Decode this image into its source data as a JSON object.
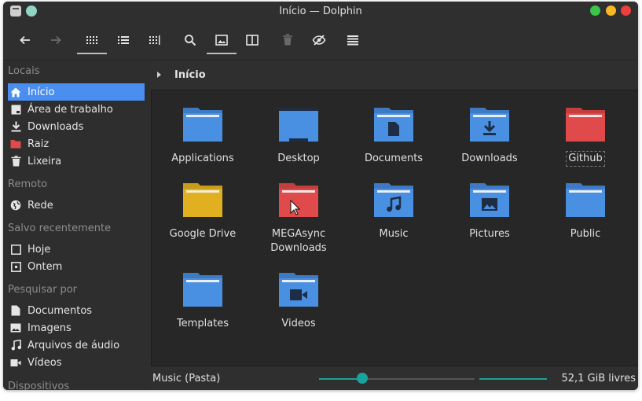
{
  "window": {
    "title": "Início — Dolphin"
  },
  "toolbar": {
    "buttons": [
      {
        "name": "back",
        "icon": "arrow-left-icon"
      },
      {
        "name": "forward",
        "icon": "arrow-right-icon"
      },
      {
        "name": "icons-view",
        "icon": "icons-view-icon",
        "active": true
      },
      {
        "name": "compact-view",
        "icon": "compact-view-icon"
      },
      {
        "name": "details-view",
        "icon": "details-view-icon"
      },
      {
        "name": "search",
        "icon": "search-icon"
      },
      {
        "name": "preview",
        "icon": "image-icon",
        "active": true
      },
      {
        "name": "split",
        "icon": "split-view-icon"
      },
      {
        "name": "trash",
        "icon": "trash-icon"
      },
      {
        "name": "hidden-files",
        "icon": "eye-off-icon"
      },
      {
        "name": "menu",
        "icon": "menu-icon"
      }
    ]
  },
  "sidebar": {
    "sections": {
      "locais": "Locais",
      "remoto": "Remoto",
      "recentes": "Salvo recentemente",
      "pesquisar": "Pesquisar por",
      "dispositivos": "Dispositivos"
    },
    "locais": [
      {
        "label": "Início",
        "icon": "home-icon",
        "selected": true
      },
      {
        "label": "Área de trabalho",
        "icon": "desktop-icon"
      },
      {
        "label": "Downloads",
        "icon": "download-icon"
      },
      {
        "label": "Raiz",
        "icon": "red-folder-icon"
      },
      {
        "label": "Lixeira",
        "icon": "trash-icon"
      }
    ],
    "remoto": [
      {
        "label": "Rede",
        "icon": "network-icon"
      }
    ],
    "recentes": [
      {
        "label": "Hoje",
        "icon": "calendar-today-icon"
      },
      {
        "label": "Ontem",
        "icon": "calendar-yesterday-icon"
      }
    ],
    "pesquisar": [
      {
        "label": "Documentos",
        "icon": "document-icon"
      },
      {
        "label": "Imagens",
        "icon": "image-icon"
      },
      {
        "label": "Arquivos de áudio",
        "icon": "music-icon"
      },
      {
        "label": "Vídeos",
        "icon": "video-icon"
      }
    ]
  },
  "breadcrumb": {
    "current": "Início"
  },
  "files": [
    {
      "label": "Applications",
      "color": "#4a90e2",
      "emblem": "none"
    },
    {
      "label": "Desktop",
      "color": "#4a90e2",
      "emblem": "desktop"
    },
    {
      "label": "Documents",
      "color": "#4a90e2",
      "emblem": "document"
    },
    {
      "label": "Downloads",
      "color": "#4a90e2",
      "emblem": "download"
    },
    {
      "label": "Github",
      "color": "#e04a4a",
      "emblem": "none",
      "focused": true
    },
    {
      "label": "Google Drive",
      "color": "#e0b020",
      "emblem": "none"
    },
    {
      "label": "MEGAsync\nDownloads",
      "label_line1": "MEGAsync",
      "label_line2": "Downloads",
      "color": "#e04a4a",
      "emblem": "none"
    },
    {
      "label": "Music",
      "color": "#4a90e2",
      "emblem": "music"
    },
    {
      "label": "Pictures",
      "color": "#4a90e2",
      "emblem": "picture"
    },
    {
      "label": "Public",
      "color": "#4a90e2",
      "emblem": "none"
    },
    {
      "label": "Templates",
      "color": "#4a90e2",
      "emblem": "none"
    },
    {
      "label": "Videos",
      "color": "#4a90e2",
      "emblem": "video"
    }
  ],
  "status": {
    "selection": "Music (Pasta)",
    "zoom_fraction": 0.28,
    "free_space": "52,1 GiB livres",
    "used_fraction": 1.0
  },
  "colors": {
    "accent": "#4a8ff0",
    "slider": "#1aa39a",
    "folder_blue": "#4a90e2",
    "folder_red": "#e04a4a",
    "folder_yellow": "#e0b020"
  }
}
